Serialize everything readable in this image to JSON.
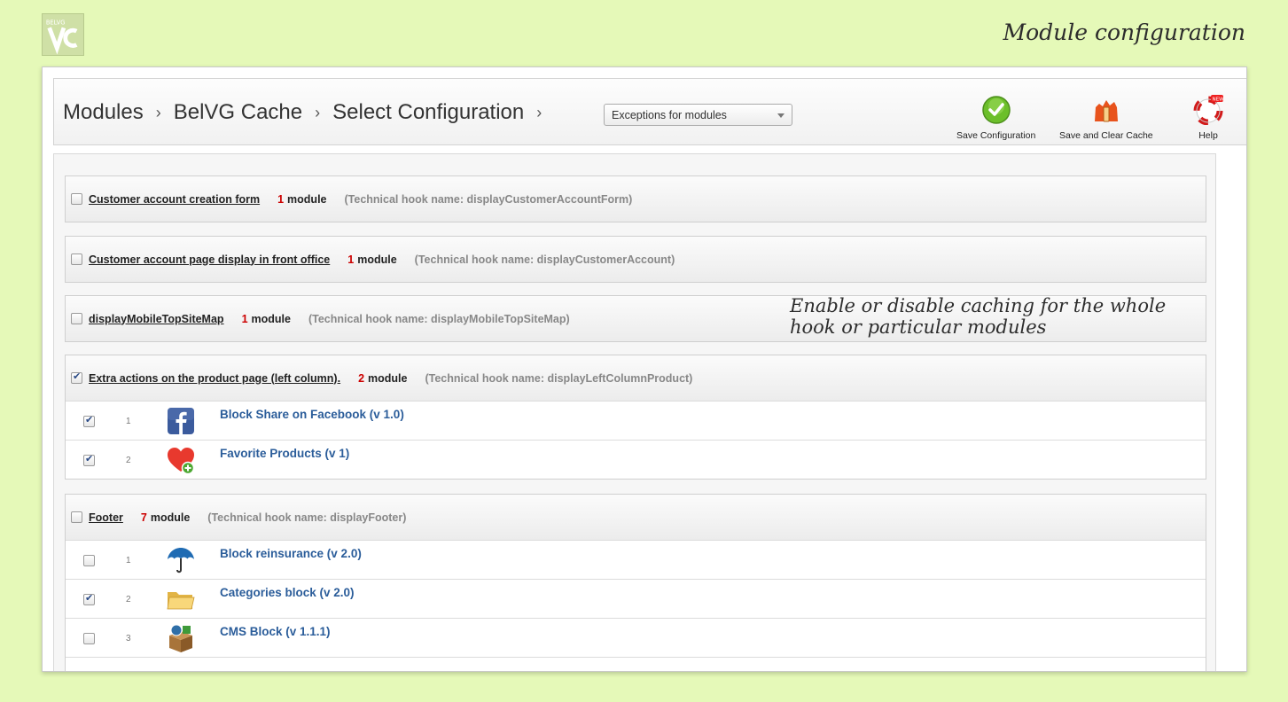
{
  "logo": {
    "icon": "belvg-logo-icon",
    "text": "BELVG"
  },
  "caption": {
    "title": "Module configuration"
  },
  "toolbar": {
    "breadcrumb": [
      "Modules",
      "BelVG Cache",
      "Select Configuration"
    ],
    "separator": "›",
    "select_value": "Exceptions for modules",
    "buttons": [
      {
        "label": "Save Configuration",
        "icon": "check-circle-icon"
      },
      {
        "label": "Save and Clear Cache",
        "icon": "clear-cache-icon"
      },
      {
        "label": "Help",
        "icon": "lifebuoy-icon"
      }
    ]
  },
  "hooks": [
    {
      "title": "Customer account creation form",
      "count": "1",
      "count_label": "module",
      "tech": "(Technical hook name: displayCustomerAccountForm)",
      "checked": false,
      "modules": []
    },
    {
      "title": "Customer account page display in front office",
      "count": "1",
      "count_label": "module",
      "tech": "(Technical hook name: displayCustomerAccount)",
      "checked": false,
      "modules": []
    },
    {
      "title": "displayMobileTopSiteMap",
      "count": "1",
      "count_label": "module",
      "tech": "(Technical hook name: displayMobileTopSiteMap)",
      "checked": false,
      "modules": []
    },
    {
      "title": "Extra actions on the product page (left column).",
      "count": "2",
      "count_label": "module",
      "tech": "(Technical hook name: displayLeftColumnProduct)",
      "checked": true,
      "modules": [
        {
          "pos": "1",
          "name": "Block Share on Facebook (v 1.0)",
          "icon": "facebook-icon",
          "checked": true
        },
        {
          "pos": "2",
          "name": "Favorite Products (v 1)",
          "icon": "heart-icon",
          "checked": true
        }
      ]
    },
    {
      "title": "Footer",
      "count": "7",
      "count_label": "module",
      "tech": "(Technical hook name: displayFooter)",
      "checked": false,
      "modules": [
        {
          "pos": "1",
          "name": "Block reinsurance (v 2.0)",
          "icon": "umbrella-icon",
          "checked": false
        },
        {
          "pos": "2",
          "name": "Categories block (v 2.0)",
          "icon": "folder-icon",
          "checked": true
        },
        {
          "pos": "3",
          "name": "CMS Block (v 1.1.1)",
          "icon": "cms-box-icon",
          "checked": false
        }
      ]
    }
  ],
  "annotation": {
    "line1": "Enable or disable caching for the whole",
    "line2": "hook or particular modules"
  }
}
